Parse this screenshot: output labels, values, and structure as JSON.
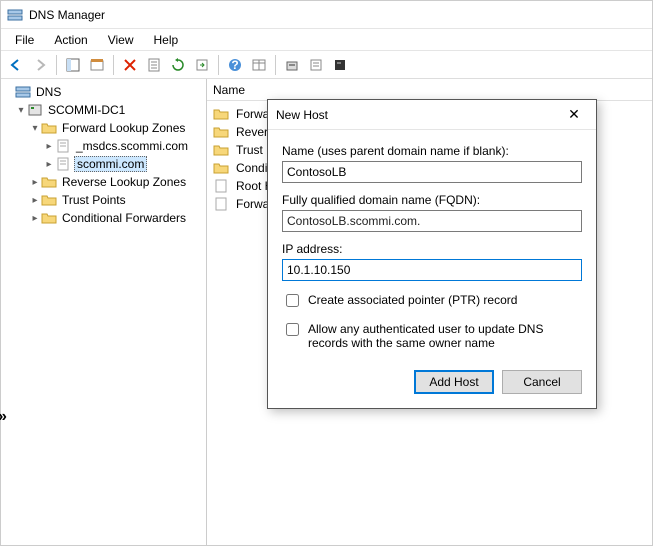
{
  "window": {
    "title": "DNS Manager"
  },
  "menu": {
    "file": "File",
    "action": "Action",
    "view": "View",
    "help": "Help"
  },
  "tree": {
    "root": "DNS",
    "server": "SCOMMI-DC1",
    "flz": "Forward Lookup Zones",
    "msdcs": "_msdcs.scommi.com",
    "scommi": "scommi.com",
    "rlz": "Reverse Lookup Zones",
    "tp": "Trust Points",
    "cf": "Conditional Forwarders"
  },
  "list": {
    "header": "Name",
    "items": [
      {
        "label": "Forward L"
      },
      {
        "label": "Reverse L"
      },
      {
        "label": "Trust Poi"
      },
      {
        "label": "Condition"
      },
      {
        "label": "Root Hint"
      },
      {
        "label": "Forwarde"
      }
    ]
  },
  "dialog": {
    "title": "New Host",
    "name_label": "Name (uses parent domain name if blank):",
    "name_value": "ContosoLB",
    "fqdn_label": "Fully qualified domain name (FQDN):",
    "fqdn_value": "ContosoLB.scommi.com.",
    "ip_label": "IP address:",
    "ip_value": "10.1.10.150",
    "chk_ptr": "Create associated pointer (PTR) record",
    "chk_auth": "Allow any authenticated user to update DNS records with the same owner name",
    "btn_add": "Add Host",
    "btn_cancel": "Cancel"
  }
}
